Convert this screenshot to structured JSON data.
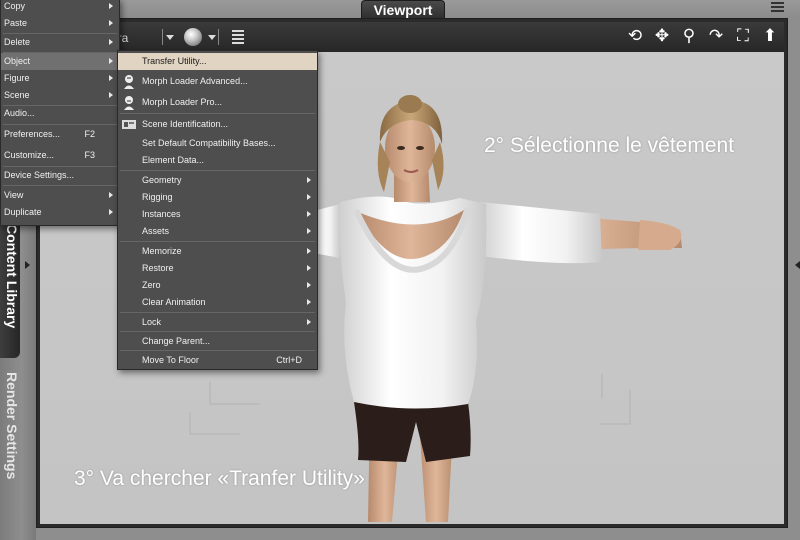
{
  "panel": {
    "title": "Viewport"
  },
  "side_tabs": {
    "content_library": "Content Library",
    "render_settings": "Render Settings"
  },
  "toolbar": {
    "camera_label": "era",
    "icons": [
      "orbit-icon",
      "pan-icon",
      "zoom-icon",
      "rotate-icon",
      "frame-icon",
      "up-icon"
    ]
  },
  "main_menu": {
    "items": [
      {
        "label": "Copy",
        "arrow": true
      },
      {
        "label": "Paste",
        "arrow": true
      },
      {
        "label": "Delete",
        "arrow": true
      },
      {
        "label": "Object",
        "arrow": true,
        "selected": true
      },
      {
        "label": "Figure",
        "arrow": true
      },
      {
        "label": "Scene",
        "arrow": true
      },
      {
        "label": "Audio..."
      },
      {
        "label": "Preferences...",
        "shortcut": "F2"
      },
      {
        "label": "Customize...",
        "shortcut": "F3"
      },
      {
        "label": "Device Settings..."
      },
      {
        "label": "View",
        "arrow": true
      },
      {
        "label": "Duplicate",
        "arrow": true
      }
    ]
  },
  "object_submenu": {
    "items": [
      {
        "label": "Transfer Utility...",
        "highlighted": true,
        "icon": "transfer-utility-icon"
      },
      {
        "label": "Morph Loader Advanced...",
        "icon": "morph-loader-advanced-icon"
      },
      {
        "label": "Morph Loader Pro...",
        "icon": "morph-loader-pro-icon"
      },
      {
        "label": "Scene Identification...",
        "icon": "scene-identification-icon"
      },
      {
        "label": "Set Default Compatibility Bases..."
      },
      {
        "label": "Element Data..."
      },
      {
        "label": "Geometry",
        "arrow": true
      },
      {
        "label": "Rigging",
        "arrow": true
      },
      {
        "label": "Instances",
        "arrow": true
      },
      {
        "label": "Assets",
        "arrow": true
      },
      {
        "label": "Memorize",
        "arrow": true
      },
      {
        "label": "Restore",
        "arrow": true
      },
      {
        "label": "Zero",
        "arrow": true
      },
      {
        "label": "Clear Animation",
        "arrow": true
      },
      {
        "label": "Lock",
        "arrow": true
      },
      {
        "label": "Change Parent..."
      },
      {
        "label": "Move To Floor",
        "shortcut": "Ctrl+D"
      }
    ]
  },
  "annotations": {
    "step2": "2°   Sélectionne le vêtement",
    "step3": "3°   Va chercher «Tranfer Utility»"
  },
  "colors": {
    "menu_bg": "#4e4e4e",
    "menu_highlight": "#e2d4c2",
    "viewport_bg": "#c7c7c7",
    "panel_dark": "#2b2b2b"
  }
}
